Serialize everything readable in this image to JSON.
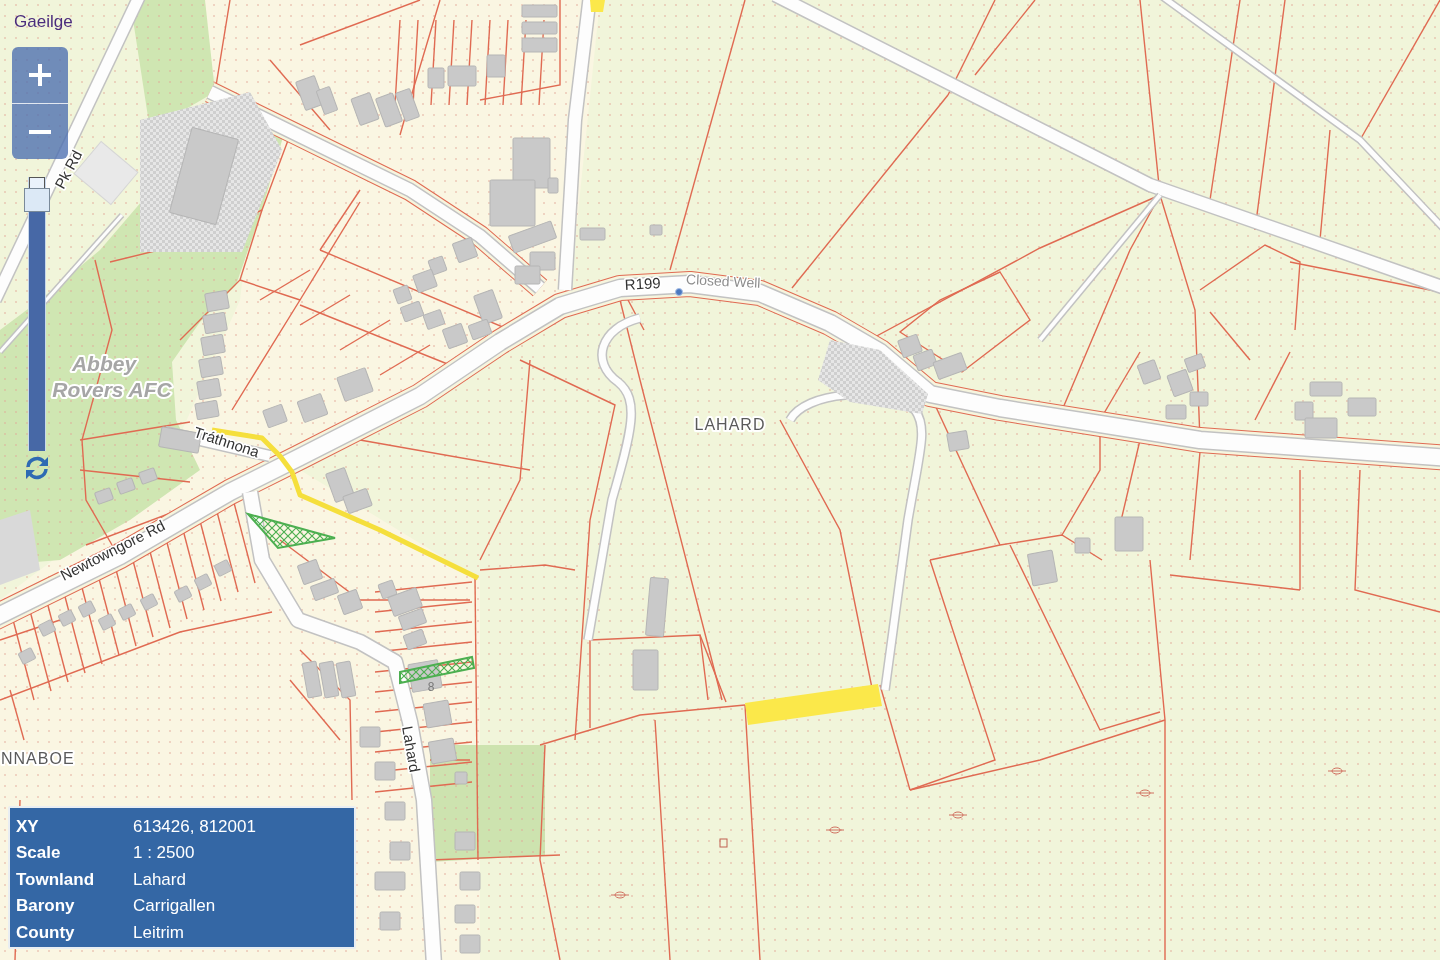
{
  "language_link": {
    "label": "Gaeilge"
  },
  "zoom_slider": {
    "level": 1
  },
  "map": {
    "labels": [
      {
        "kind": "road",
        "text": "Pk Rd"
      },
      {
        "kind": "road",
        "text": "R199"
      },
      {
        "kind": "feature",
        "text": "Closed Well"
      },
      {
        "kind": "area",
        "lines": [
          "Abbey",
          "Rovers AFC"
        ]
      },
      {
        "kind": "townland",
        "text": "LAHARD"
      },
      {
        "kind": "road",
        "text": "Tráthnona"
      },
      {
        "kind": "road",
        "text": "Newtowngore Rd"
      },
      {
        "kind": "house_number",
        "text": "8"
      },
      {
        "kind": "road",
        "text": "Lahard"
      },
      {
        "kind": "townland",
        "text": "NNABOE"
      }
    ]
  },
  "info_panel": {
    "rows": [
      {
        "label": "XY",
        "value": "613426, 812001"
      },
      {
        "label": "Scale",
        "value": "1 : 2500"
      },
      {
        "label": "Townland",
        "value": "Lahard"
      },
      {
        "label": "Barony",
        "value": "Carrigallen"
      },
      {
        "label": "County",
        "value": "Leitrim"
      }
    ]
  }
}
